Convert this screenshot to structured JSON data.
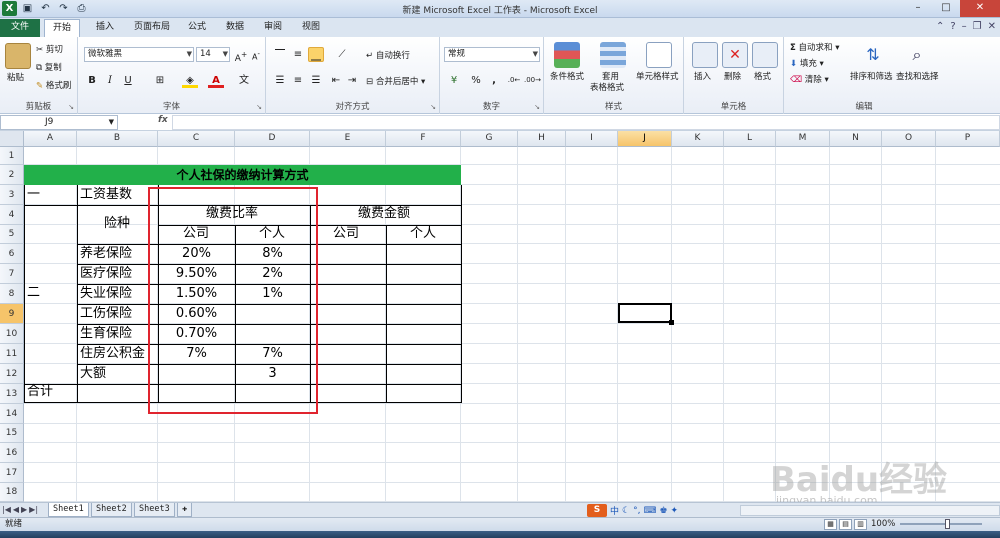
{
  "window": {
    "title": "新建 Microsoft Excel 工作表 - Microsoft Excel"
  },
  "ribbon_tabs": [
    "文件",
    "开始",
    "插入",
    "页面布局",
    "公式",
    "数据",
    "审阅",
    "视图"
  ],
  "clipboard": {
    "paste": "粘贴",
    "cut": "剪切",
    "copy": "复制",
    "format_painter": "格式刷",
    "label": "剪贴板"
  },
  "font": {
    "name": "微软雅黑",
    "size": "14",
    "bold": "B",
    "italic": "I",
    "underline": "U",
    "label": "字体"
  },
  "alignment": {
    "wrap": "自动换行",
    "merge": "合并后居中",
    "label": "对齐方式"
  },
  "number": {
    "format": "常规",
    "label": "数字"
  },
  "styles": {
    "conditional": "条件格式",
    "as_table": "套用",
    "as_table2": "表格格式",
    "cell_styles": "单元格样式",
    "label": "样式"
  },
  "cells": {
    "insert": "插入",
    "delete": "删除",
    "format": "格式",
    "label": "单元格"
  },
  "editing": {
    "autosum": "自动求和",
    "fill": "填充",
    "clear": "清除",
    "sort": "排序和筛选",
    "find": "查找和选择",
    "label": "编辑"
  },
  "formula_bar": {
    "name_box": "J9",
    "fx": "fx",
    "formula": ""
  },
  "columns": [
    "A",
    "B",
    "C",
    "D",
    "E",
    "F",
    "G",
    "H",
    "I",
    "J",
    "K",
    "L",
    "M",
    "N",
    "O",
    "P"
  ],
  "rows": [
    "1",
    "2",
    "3",
    "4",
    "5",
    "6",
    "7",
    "8",
    "9",
    "10",
    "11",
    "12",
    "13",
    "14",
    "15",
    "16",
    "17",
    "18"
  ],
  "sheet": {
    "banner": "个人社保的缴纳计算方式",
    "row3_a": "一",
    "row3_b": "工资基数",
    "xianzhong": "险种",
    "rate_header": "缴费比率",
    "amount_header": "缴费金额",
    "company": "公司",
    "personal": "个人",
    "company2": "公司",
    "personal2": "个人",
    "section_two": "二",
    "insurances": [
      {
        "name": "养老保险",
        "company": "20%",
        "personal": "8%"
      },
      {
        "name": "医疗保险",
        "company": "9.50%",
        "personal": "2%"
      },
      {
        "name": "失业保险",
        "company": "1.50%",
        "personal": "1%"
      },
      {
        "name": "工伤保险",
        "company": "0.60%",
        "personal": ""
      },
      {
        "name": "生育保险",
        "company": "0.70%",
        "personal": ""
      },
      {
        "name": "住房公积金",
        "company": "7%",
        "personal": "7%"
      },
      {
        "name": "大额",
        "company": "",
        "personal": "3"
      }
    ],
    "total": "合计"
  },
  "sheet_tabs": [
    "Sheet1",
    "Sheet2",
    "Sheet3"
  ],
  "status": {
    "ready": "就绪",
    "zoom": "100%"
  },
  "ime": {
    "logo": "S",
    "lang": "中"
  },
  "watermark": {
    "text": "Baidu经验",
    "url": "jingyan.baidu.com"
  }
}
